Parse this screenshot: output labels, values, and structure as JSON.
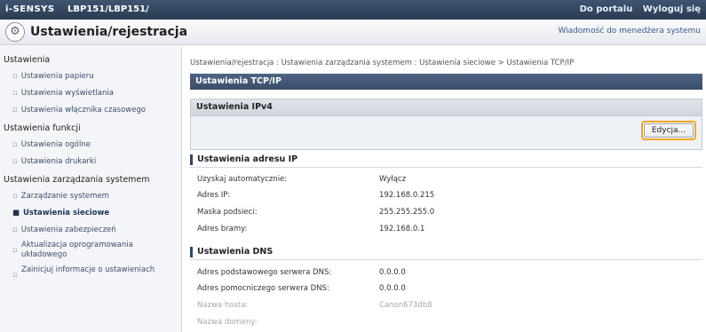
{
  "header": {
    "brand": "i-SENSYS",
    "model": "LBP151/LBP151/",
    "links": [
      "Do portalu",
      "Wyloguj się"
    ]
  },
  "titlebar": {
    "title": "Ustawienia/rejestracja",
    "message": "Wiadomość do menedżera systemu"
  },
  "sidebar": {
    "groups": [
      {
        "label": "Ustawienia",
        "items": [
          "Ustawienia papieru",
          "Ustawienia wyświetlania",
          "Ustawienia włącznika czasowego"
        ]
      },
      {
        "label": "Ustawienia funkcji",
        "items": [
          "Ustawienia ogólne",
          "Ustawienia drukarki"
        ]
      },
      {
        "label": "Ustawienia zarządzania systemem",
        "items": [
          "Zarządzanie systemem",
          "Ustawienia sieciowe",
          "Ustawienia zabezpieczeń",
          "Aktualizacja oprogramowania układowego",
          "Zainicjuj informacje o ustawieniach"
        ]
      }
    ],
    "active_item": "Ustawienia sieciowe"
  },
  "main": {
    "breadcrumb": "Ustawienia/rejestracja : Ustawienia zarządzania systemem : Ustawienia sieciowe > Ustawienia TCP/IP",
    "page_title": "Ustawienia TCP/IP",
    "panel_title": "Ustawienia IPv4",
    "edit_button": "Edycja...",
    "ip_section": {
      "title": "Ustawienia adresu IP",
      "rows": [
        {
          "label": "Uzyskaj automatycznie:",
          "value": "Wyłącz"
        },
        {
          "label": "Adres IP:",
          "value": "192.168.0.215"
        },
        {
          "label": "Maska podsieci:",
          "value": "255.255.255.0"
        },
        {
          "label": "Adres bramy:",
          "value": "192.168.0.1"
        }
      ]
    },
    "dns_section": {
      "title": "Ustawienia DNS",
      "rows": [
        {
          "label": "Adres podstawowego serwera DNS:",
          "value": "0.0.0.0"
        },
        {
          "label": "Adres pomocniczego serwera DNS:",
          "value": "0.0.0.0"
        },
        {
          "label": "Nazwa hosta:",
          "value": "Canon673db8"
        },
        {
          "label": "Nazwa domeny:",
          "value": ""
        }
      ]
    }
  },
  "colors": {
    "topbar": "#2f4260",
    "page_header": "#42577a",
    "highlight": "#f3a41e"
  }
}
